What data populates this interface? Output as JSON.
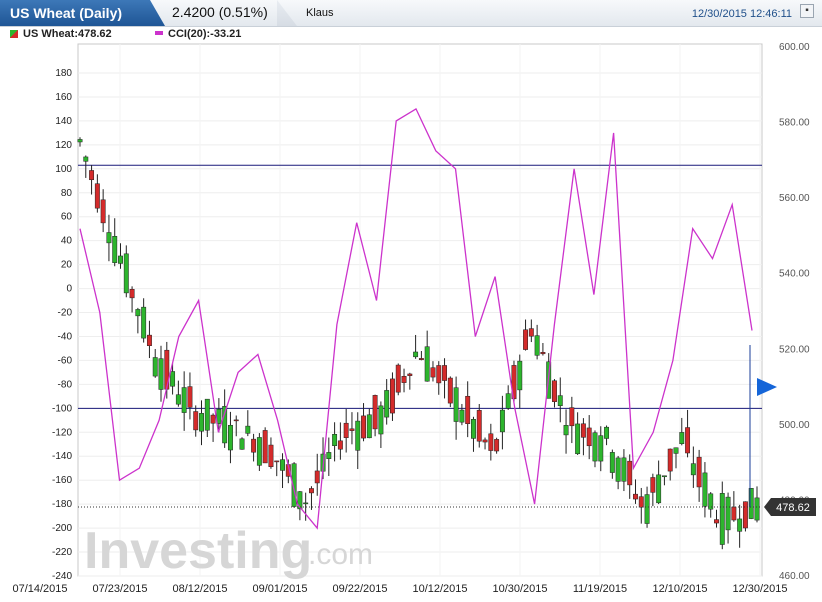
{
  "header": {
    "instrument": "US Wheat (Daily)",
    "price": "2.4200 (0.51%)",
    "user": "Klaus",
    "datetime": "12/30/2015 12:46:11"
  },
  "legend": {
    "main": "US Wheat:478.62",
    "cci": "CCI(20):-33.21"
  },
  "colors": {
    "up": "#2db52d",
    "down": "#d42b2b",
    "cci": "#cc33cc",
    "hline": "#1a1a7a",
    "pointer": "#1565d8"
  },
  "watermark": {
    "main": "Investing",
    "suffix": ".com"
  },
  "price_badge": "478.62",
  "chart_data": {
    "type": "candlestick",
    "left_axis_ticks": [
      "180",
      "160",
      "140",
      "120",
      "100",
      "80",
      "60",
      "40",
      "20",
      "0",
      "-20",
      "-40",
      "-60",
      "-80",
      "-100",
      "-120",
      "-140",
      "-160",
      "-180",
      "-200",
      "-220",
      "-240"
    ],
    "right_axis_ticks": [
      "600.00",
      "580.00",
      "560.00",
      "540.00",
      "520.00",
      "500.00",
      "480.00",
      "460.00"
    ],
    "x_tick_labels": [
      "07/14/2015",
      "07/23/2015",
      "08/12/2015",
      "09/01/2015",
      "09/22/2015",
      "10/12/2015",
      "10/30/2015",
      "11/19/2015",
      "12/10/2015",
      "12/30/2015"
    ],
    "left_ylim": [
      -240,
      180
    ],
    "right_ylim": [
      460,
      600
    ],
    "cci_hlines": [
      103,
      -100
    ],
    "last_price": 478.62,
    "ohlc_sample": [
      {
        "date": "07/14/2015",
        "open": 580,
        "high": 590,
        "low": 572,
        "close": 575
      },
      {
        "date": "07/17/2015",
        "open": 560,
        "high": 566,
        "low": 540,
        "close": 546
      },
      {
        "date": "07/23/2015",
        "open": 530,
        "high": 534,
        "low": 514,
        "close": 518
      },
      {
        "date": "07/31/2015",
        "open": 508,
        "high": 516,
        "low": 500,
        "close": 503
      },
      {
        "date": "08/12/2015",
        "open": 520,
        "high": 524,
        "low": 496,
        "close": 500
      },
      {
        "date": "08/21/2015",
        "open": 505,
        "high": 510,
        "low": 492,
        "close": 494
      },
      {
        "date": "09/01/2015",
        "open": 492,
        "high": 496,
        "low": 476,
        "close": 480
      },
      {
        "date": "09/10/2015",
        "open": 484,
        "high": 500,
        "low": 480,
        "close": 498
      },
      {
        "date": "09/22/2015",
        "open": 488,
        "high": 506,
        "low": 484,
        "close": 502
      },
      {
        "date": "10/02/2015",
        "open": 514,
        "high": 524,
        "low": 510,
        "close": 520
      },
      {
        "date": "10/12/2015",
        "open": 518,
        "high": 520,
        "low": 504,
        "close": 506
      },
      {
        "date": "10/20/2015",
        "open": 498,
        "high": 502,
        "low": 484,
        "close": 492
      },
      {
        "date": "10/30/2015",
        "open": 510,
        "high": 530,
        "low": 506,
        "close": 526
      },
      {
        "date": "11/09/2015",
        "open": 516,
        "high": 518,
        "low": 498,
        "close": 500
      },
      {
        "date": "11/19/2015",
        "open": 490,
        "high": 502,
        "low": 486,
        "close": 496
      },
      {
        "date": "11/30/2015",
        "open": 498,
        "high": 500,
        "low": 476,
        "close": 478
      },
      {
        "date": "12/10/2015",
        "open": 490,
        "high": 500,
        "low": 484,
        "close": 496
      },
      {
        "date": "12/22/2015",
        "open": 484,
        "high": 486,
        "low": 472,
        "close": 475
      },
      {
        "date": "12/30/2015",
        "open": 476,
        "high": 480,
        "low": 473,
        "close": 478.62
      }
    ]
  }
}
